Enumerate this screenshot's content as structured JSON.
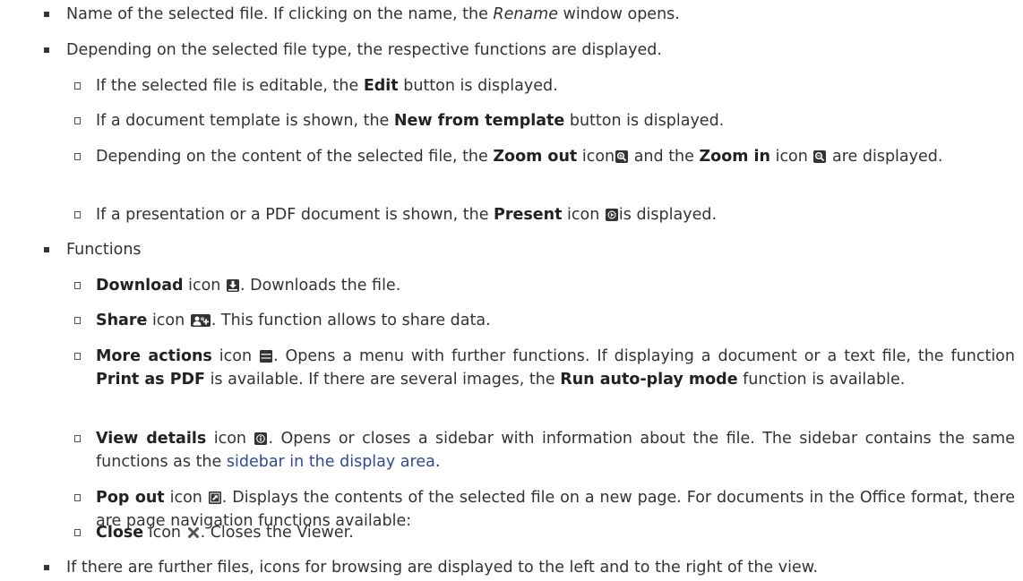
{
  "items": [
    {
      "a": "Name of the selected file. If clicking on the name, the ",
      "b": "Rename",
      "c": " window opens."
    },
    {
      "text": "Depending on the selected file type, the respective functions are displayed."
    },
    {
      "a": "If the selected file is editable, the ",
      "b": "Edit",
      "c": " button is displayed."
    },
    {
      "a": "If a document template is shown, the ",
      "b": "New from template",
      "c": " button is displayed."
    },
    {
      "a": "Depending on the content of the selected file, the ",
      "b": "Zoom out",
      "c": " icon",
      "d": " and the ",
      "e": "Zoom in",
      "f": " icon ",
      "g": " are displayed."
    },
    {
      "a": "If a presentation or a PDF document is shown, the ",
      "b": "Present",
      "c": " icon ",
      "d": "is displayed."
    },
    {
      "text": "Functions"
    },
    {
      "b": "Download",
      "c": " icon ",
      "d": ". Downloads the file."
    },
    {
      "b": "Share",
      "c": " icon ",
      "d": ". This function allows to share data."
    },
    {
      "b": "More actions",
      "c": " icon ",
      "d": ". Opens a menu with further functions. If displaying a document or a text file, the function ",
      "e": "Print as PDF",
      "f": " is available. If there are several images, the ",
      "g": "Run auto-play mode",
      "h": " function is available."
    },
    {
      "b": "View details",
      "c": " icon ",
      "d": ". Opens or closes a sidebar with information about the file. The sidebar contains the same functions as the ",
      "link": "sidebar in the display area",
      "e": "."
    },
    {
      "b": "Pop out",
      "c": " icon ",
      "d": ". Displays the contents of the selected file on a new page. For documents in the Office format, there are page navigation functions available:"
    },
    {
      "b": "Close",
      "c": " icon ",
      "d": ". Closes the Viewer."
    },
    {
      "text": "If there are further files, icons for browsing are displayed to the left and to the right of the view."
    }
  ],
  "icons": [
    "zoom-in-icon",
    "zoom-out-icon",
    "present-icon",
    "download-icon",
    "share-icon",
    "more-actions-icon",
    "view-details-icon",
    "pop-out-icon",
    "close-icon"
  ],
  "colors": {
    "text": "#333333",
    "link": "#2b4a9e",
    "icon": "#333333"
  }
}
